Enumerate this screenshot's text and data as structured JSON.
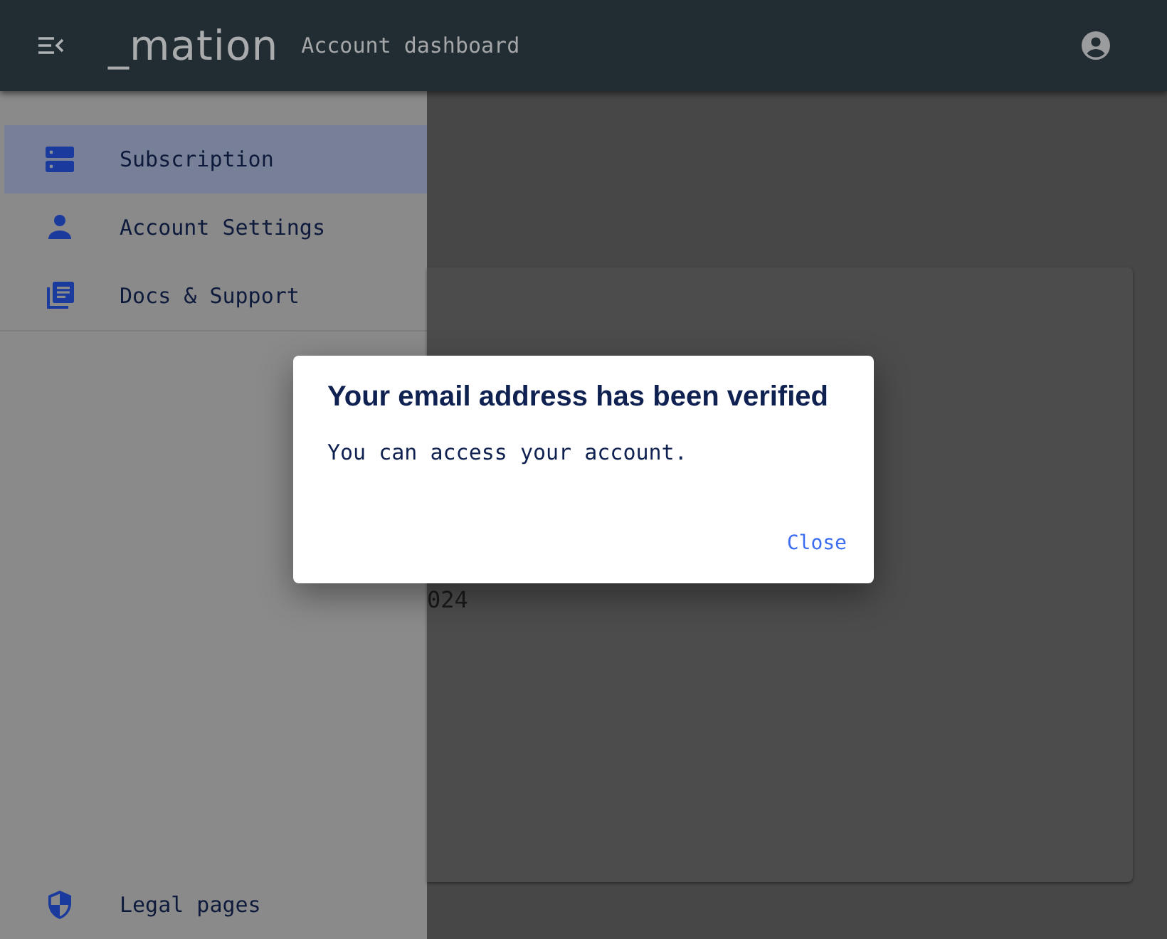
{
  "header": {
    "logo": "_mation",
    "title": "Account dashboard"
  },
  "sidebar": {
    "items": [
      {
        "label": "Subscription",
        "selected": true
      },
      {
        "label": "Account Settings",
        "selected": false
      },
      {
        "label": "Docs & Support",
        "selected": false
      }
    ],
    "footer_item": {
      "label": "Legal pages",
      "selected": false
    }
  },
  "card": {
    "text": "024"
  },
  "dialog": {
    "title": "Your email address has been verified",
    "message": "You can access your account.",
    "button": "Close"
  }
}
